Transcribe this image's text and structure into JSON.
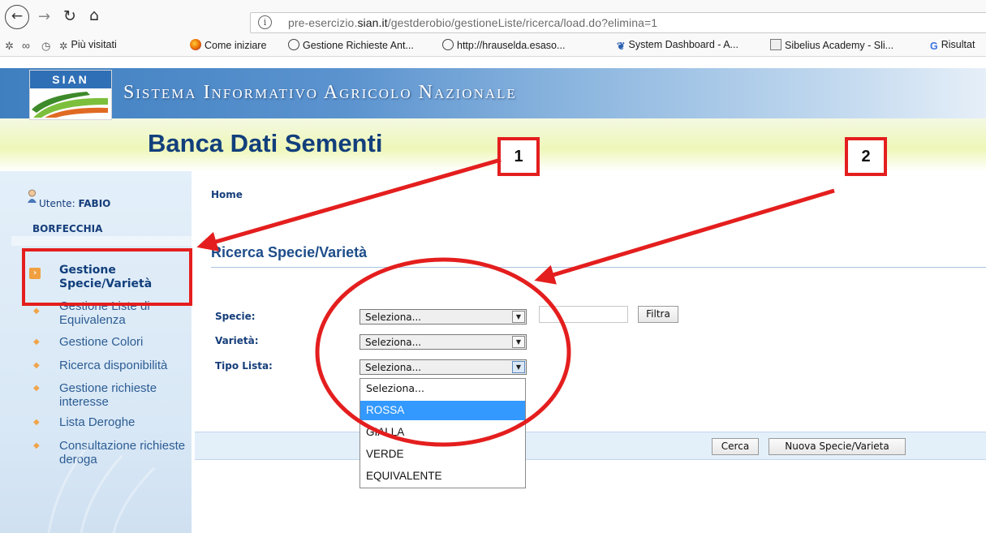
{
  "browser": {
    "url_prefix": "pre-esercizio.",
    "url_domain": "sian.it",
    "url_path": "/gestderobio/gestioneListe/ricerca/load.do?elimina=1",
    "bookmarks": [
      {
        "label": "Più visitati",
        "icon": "gear-star-icon"
      },
      {
        "label": "Come iniziare",
        "icon": "firefox-icon"
      },
      {
        "label": "Gestione Richieste Ant...",
        "icon": "globe-icon"
      },
      {
        "label": "http://hrauselda.esaso...",
        "icon": "globe-icon"
      },
      {
        "label": "System Dashboard - A...",
        "icon": "jira-icon"
      },
      {
        "label": "Sibelius Academy - Sli...",
        "icon": "sibelius-icon"
      },
      {
        "label": "Risultat",
        "icon": "google-icon"
      }
    ]
  },
  "header": {
    "logo_text": "SIAN",
    "sian_title": "Sistema Informativo Agricolo Nazionale",
    "banca_title": "Banca Dati Sementi"
  },
  "sidebar": {
    "user_label": "Utente:",
    "user_first": "FABIO",
    "user_last": "BORFECCHIA",
    "items": [
      {
        "label": "Gestione Specie/Varietà"
      },
      {
        "label": "Gestione Liste di Equivalenza"
      },
      {
        "label": "Gestione Colori"
      },
      {
        "label": "Ricerca disponibilità"
      },
      {
        "label": "Gestione richieste interesse"
      },
      {
        "label": "Lista Deroghe"
      },
      {
        "label": "Consultazione richieste deroga"
      }
    ]
  },
  "main": {
    "breadcrumb": "Home",
    "title": "Ricerca Specie/Varietà",
    "form": {
      "specie_label": "Specie:",
      "varieta_label": "Varietà:",
      "tipo_label": "Tipo Lista:",
      "specie_value": "Seleziona...",
      "varieta_value": "Seleziona...",
      "tipo_value": "Seleziona...",
      "filtra_label": "Filtra",
      "tipo_options": [
        "Seleziona...",
        "ROSSA",
        "GIALLA",
        "VERDE",
        "EQUIVALENTE"
      ],
      "tipo_highlighted": "ROSSA"
    },
    "actions": {
      "cerca_label": "Cerca",
      "nuova_label": "Nuova Specie/Varieta"
    }
  },
  "annotations": {
    "label_1": "1",
    "label_2": "2",
    "color": "#e41e1e"
  }
}
